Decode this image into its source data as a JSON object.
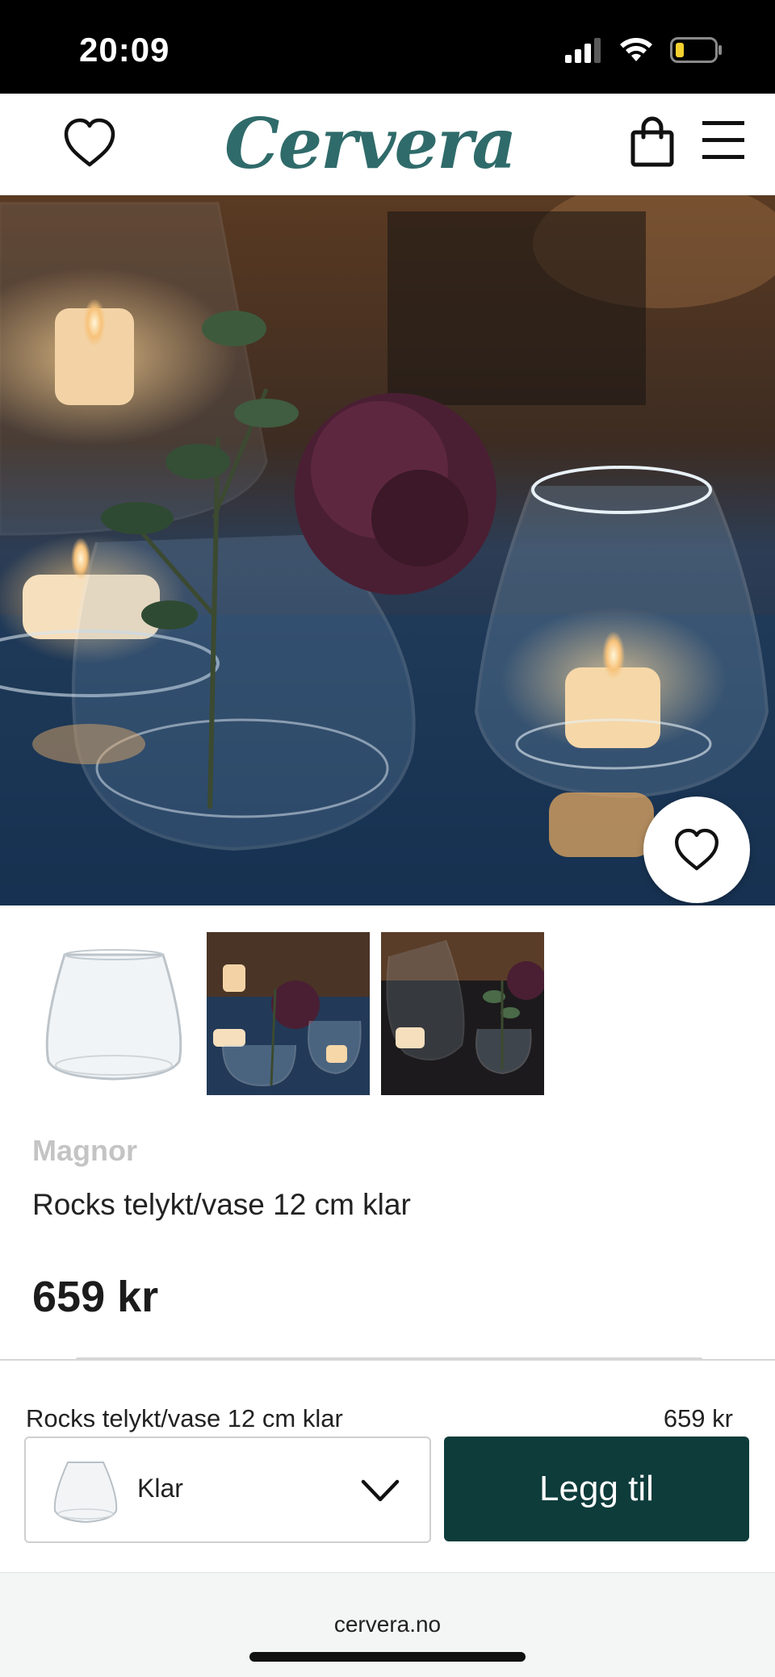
{
  "status_bar": {
    "time": "20:09"
  },
  "header": {
    "brand_logo": "Cervera"
  },
  "product": {
    "brand": "Magnor",
    "title": "Rocks telykt/vase 12 cm klar",
    "price": "659 kr"
  },
  "sticky_bar": {
    "name": "Rocks telykt/vase 12 cm klar",
    "price": "659 kr",
    "variant_selected": "Klar",
    "add_button_label": "Legg til"
  },
  "browser": {
    "url": "cervera.no"
  },
  "colors": {
    "brand": "#2f6b6a",
    "button": "#0d3c3b",
    "status_bar": "#000000",
    "muted_brand_text": "#c4c4c4"
  },
  "icons": [
    "signal-icon",
    "wifi-icon",
    "battery-icon",
    "heart-icon",
    "shopping-bag-icon",
    "hamburger-menu-icon",
    "chevron-down-icon"
  ]
}
